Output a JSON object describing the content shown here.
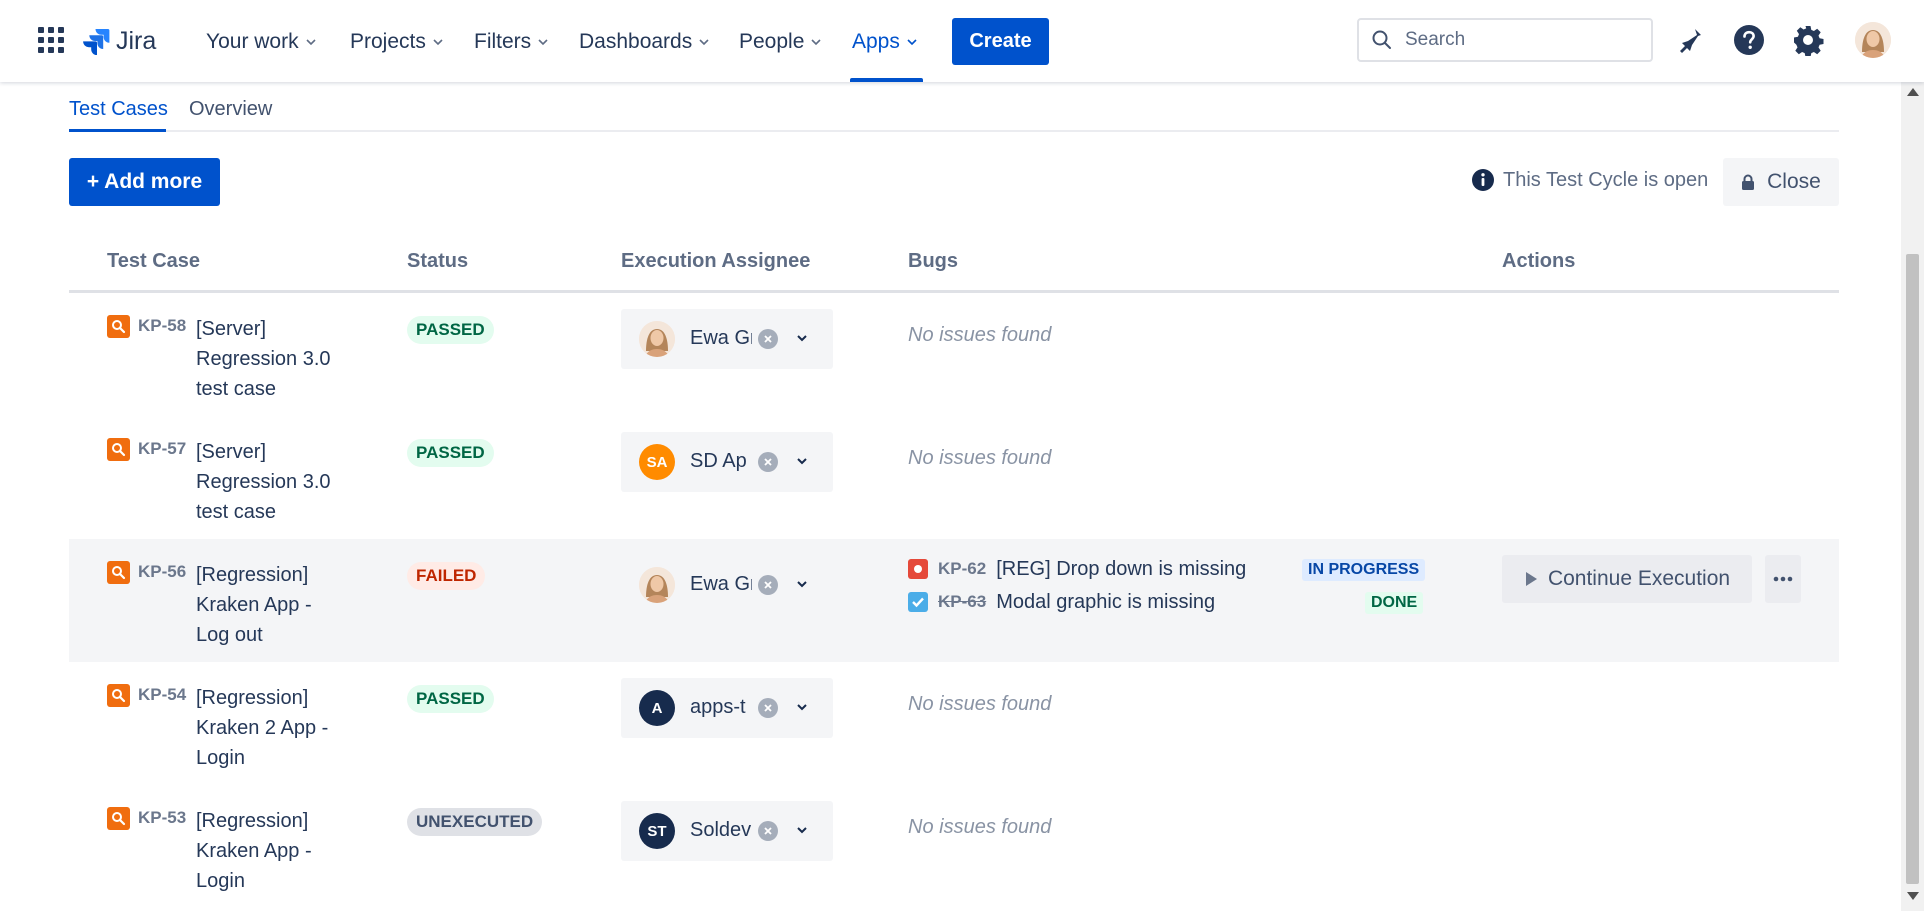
{
  "nav": {
    "logo_text": "Jira",
    "items": [
      {
        "label": "Your work"
      },
      {
        "label": "Projects"
      },
      {
        "label": "Filters"
      },
      {
        "label": "Dashboards"
      },
      {
        "label": "People"
      },
      {
        "label": "Apps"
      }
    ],
    "active_item": "Apps",
    "create_label": "Create",
    "search_placeholder": "Search"
  },
  "tabs": [
    {
      "label": "Test Cases",
      "active": true
    },
    {
      "label": "Overview",
      "active": false
    }
  ],
  "toolbar": {
    "add_more_label": "+ Add more",
    "cycle_status": "This Test Cycle is open",
    "close_label": "Close"
  },
  "table": {
    "headers": [
      "Test Case",
      "Status",
      "Execution Assignee",
      "Bugs",
      "Actions"
    ],
    "rows": [
      {
        "key": "KP-58",
        "title": "[Server] Regression 3.0 test case",
        "status": "PASSED",
        "assignee": {
          "name": "Ewa Gr",
          "avatar": "photo"
        },
        "bugs_empty": "No issues found"
      },
      {
        "key": "KP-57",
        "title": "[Server] Regression 3.0 test case",
        "status": "PASSED",
        "assignee": {
          "name": "SD Ap",
          "initials": "SA",
          "color": "#ff8b00"
        },
        "bugs_empty": "No issues found"
      },
      {
        "key": "KP-56",
        "title": "[Regression] Kraken App - Log out",
        "status": "FAILED",
        "assignee": {
          "name": "Ewa Gr",
          "avatar": "photo"
        },
        "bugs": [
          {
            "key": "KP-62",
            "title": "[REG] Drop down is missing",
            "status": "IN PROGRESS",
            "icon": "bug-icon"
          },
          {
            "key": "KP-63",
            "title": "Modal graphic is missing",
            "status": "DONE",
            "icon": "task-icon"
          }
        ],
        "actions": {
          "continue_label": "Continue Execution"
        }
      },
      {
        "key": "KP-54",
        "title": "[Regression] Kraken 2 App - Login",
        "status": "PASSED",
        "assignee": {
          "name": "apps-t",
          "initials": "A",
          "color": "#172b4d"
        },
        "bugs_empty": "No issues found"
      },
      {
        "key": "KP-53",
        "title": "[Regression] Kraken App - Login",
        "status": "UNEXECUTED",
        "assignee": {
          "name": "Soldev",
          "initials": "ST",
          "color": "#172b4d"
        },
        "bugs_empty": "No issues found"
      }
    ]
  },
  "colors": {
    "brand": "#0052cc",
    "text": "#172b4d",
    "passed_bg": "#e3fcef",
    "failed_bg": "#ffebe6",
    "unexecuted_bg": "#dfe1e6"
  }
}
